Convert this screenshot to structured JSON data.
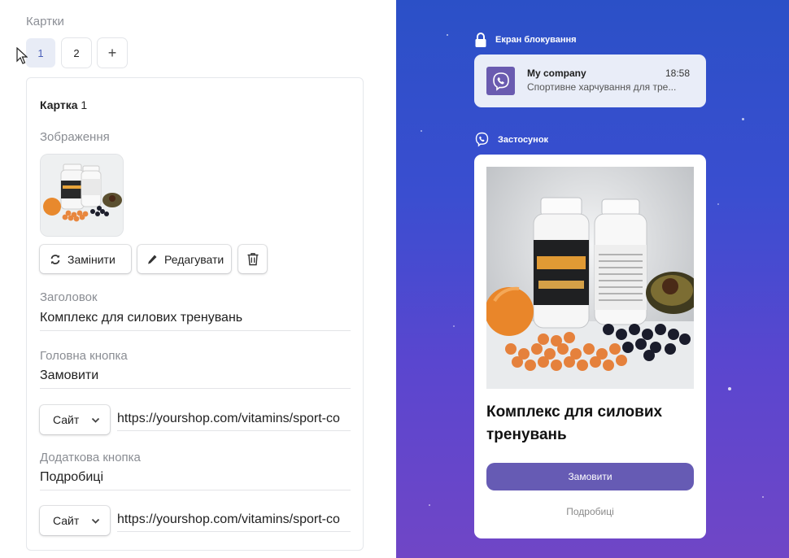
{
  "editor": {
    "section_title": "Картки",
    "tabs": [
      "1",
      "2",
      "+"
    ],
    "card": {
      "title_bold": "Картка",
      "title_num": "1",
      "image_label": "Зображення",
      "replace_label": "Замінити",
      "edit_label": "Редагувати",
      "heading_label": "Заголовок",
      "heading_value": "Комплекс для силових тренувань",
      "main_button_label": "Головна кнопка",
      "main_button_value": "Замовити",
      "main_select": "Сайт",
      "main_url": "https://yourshop.com/vitamins/sport-co",
      "extra_button_label": "Додаткова кнопка",
      "extra_button_value": "Подробиці",
      "extra_select": "Сайт",
      "extra_url": "https://yourshop.com/vitamins/sport-co"
    }
  },
  "preview": {
    "lock_label": "Екран блокування",
    "notification": {
      "sender": "My company",
      "time": "18:58",
      "text": "Спортивне харчування для тре..."
    },
    "app_label": "Застосунок",
    "card": {
      "title": "Комплекс для силових тренувань",
      "primary_button": "Замовити",
      "secondary_link": "Подробиці"
    }
  },
  "colors": {
    "accent": "#665bb4",
    "preview_bg_top": "#2b50c7",
    "preview_bg_bottom": "#7046c6",
    "active_tab_bg": "#e8ecf6"
  }
}
